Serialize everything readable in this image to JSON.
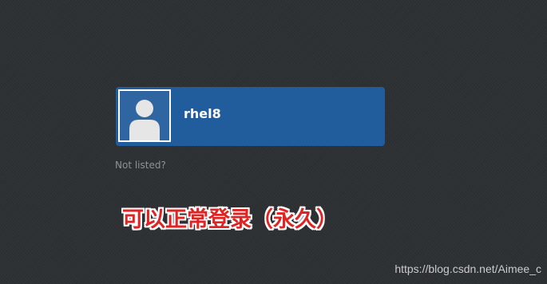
{
  "user_list": {
    "items": [
      {
        "username": "rhel8",
        "avatar_icon": "user-silhouette-icon"
      }
    ]
  },
  "not_listed_label": "Not listed?",
  "annotation_text": "可以正常登录（永久）",
  "watermark_text": "https://blog.csdn.net/Aimee_c",
  "colors": {
    "background": "#2e3133",
    "selected_user": "#215d9c",
    "annotation": "#e02323"
  }
}
